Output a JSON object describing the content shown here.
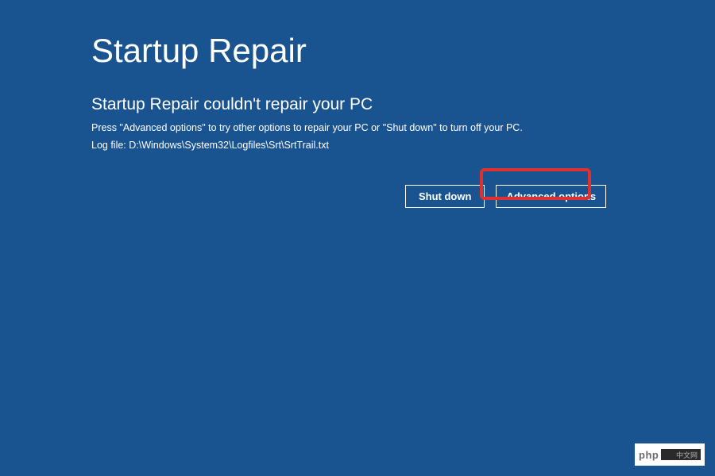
{
  "header": {
    "title": "Startup Repair"
  },
  "main": {
    "subtitle": "Startup Repair couldn't repair your PC",
    "instruction": "Press \"Advanced options\" to try other options to repair your PC or \"Shut down\" to turn off your PC.",
    "logfile": "Log file: D:\\Windows\\System32\\Logfiles\\Srt\\SrtTrail.txt"
  },
  "buttons": {
    "shutdown_label": "Shut down",
    "advanced_label": "Advanced options"
  },
  "watermark": {
    "text": "php",
    "suffix": "中文网"
  }
}
